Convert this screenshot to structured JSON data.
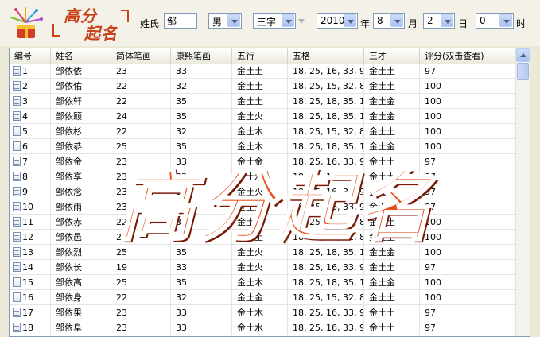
{
  "app": {
    "logo_line1": "高分",
    "logo_line2": "起名"
  },
  "form": {
    "surname_label": "姓氏",
    "surname_value": "邹",
    "gender_value": "男",
    "namelen_value": "三字",
    "year_value": "2010",
    "year_label": "年",
    "month_value": "8",
    "month_label": "月",
    "day_value": "2",
    "day_label": "日",
    "hour_value": "0",
    "hour_label": "时"
  },
  "table": {
    "columns": [
      "编号",
      "姓名",
      "简体笔画",
      "康熙笔画",
      "五行",
      "五格",
      "三才",
      "评分(双击查看)"
    ],
    "rows": [
      [
        "1",
        "邹依依",
        "23",
        "33",
        "金土土",
        "18, 25, 16, 33, 9",
        "金土土",
        "97"
      ],
      [
        "2",
        "邹依佑",
        "22",
        "32",
        "金土土",
        "18, 25, 15, 32, 8",
        "金土土",
        "100"
      ],
      [
        "3",
        "邹依轩",
        "22",
        "35",
        "金土土",
        "18, 25, 18, 35, 11",
        "金土金",
        "100"
      ],
      [
        "4",
        "邹依颐",
        "24",
        "35",
        "金土火",
        "18, 25, 18, 35, 11",
        "金土金",
        "100"
      ],
      [
        "5",
        "邹依杉",
        "22",
        "32",
        "金土木",
        "18, 25, 15, 32, 8",
        "金土土",
        "100"
      ],
      [
        "6",
        "邹依恭",
        "25",
        "35",
        "金土木",
        "18, 25, 18, 35, 11",
        "金土金",
        "100"
      ],
      [
        "7",
        "邹依金",
        "23",
        "33",
        "金土金",
        "18, 25, 16, 33, 9",
        "金土土",
        "97"
      ],
      [
        "8",
        "邹依享",
        "23",
        "33",
        "金土水",
        "18, 25, 16, 33, 9",
        "金土土",
        "97"
      ],
      [
        "9",
        "邹依念",
        "23",
        "33",
        "金土火",
        "18, 25, 16, 33, 9",
        "金土土",
        "97"
      ],
      [
        "10",
        "邹依雨",
        "23",
        "33",
        "金土火",
        "18, 25, 16, 33, 9",
        "金土土",
        "97"
      ],
      [
        "11",
        "邹依赤",
        "22",
        "32",
        "金土金",
        "18, 25, 15, 32, 8",
        "金土土",
        "100"
      ],
      [
        "12",
        "邹依邑",
        "22",
        "32",
        "金土土",
        "18, 25, 15, 32, 8",
        "金土土",
        "100"
      ],
      [
        "13",
        "邹依烈",
        "25",
        "35",
        "金土火",
        "18, 25, 18, 35, 11",
        "金土金",
        "100"
      ],
      [
        "14",
        "邹依长",
        "19",
        "33",
        "金土火",
        "18, 25, 16, 33, 9",
        "金土土",
        "97"
      ],
      [
        "15",
        "邹依高",
        "25",
        "35",
        "金土木",
        "18, 25, 18, 35, 11",
        "金土金",
        "100"
      ],
      [
        "16",
        "邹依身",
        "22",
        "32",
        "金土金",
        "18, 25, 15, 32, 8",
        "金土土",
        "100"
      ],
      [
        "17",
        "邹依果",
        "23",
        "33",
        "金土木",
        "18, 25, 16, 33, 9",
        "金土土",
        "97"
      ],
      [
        "18",
        "邹依阜",
        "23",
        "33",
        "金土水",
        "18, 25, 16, 33, 9",
        "金土土",
        "97"
      ]
    ]
  },
  "overlay_text": "高分起名",
  "colors": {
    "brand_red": "#c8421c",
    "overlay_orange": "#e8501c"
  },
  "icons": [
    "firework-logo-icon",
    "dropdown-arrow-icon",
    "row-document-icon",
    "scroll-up-icon"
  ]
}
